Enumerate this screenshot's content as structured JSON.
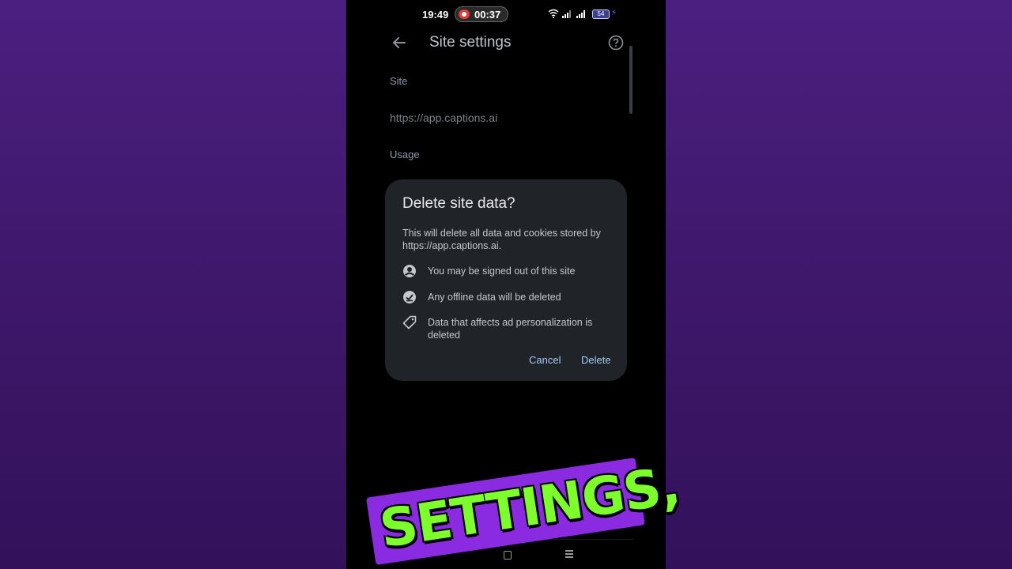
{
  "status_bar": {
    "time": "19:49",
    "recording_time": "00:37",
    "battery_level": "54"
  },
  "app_bar": {
    "title": "Site settings"
  },
  "site_section": {
    "label": "Site",
    "url": "https://app.captions.ai"
  },
  "usage_section": {
    "label": "Usage"
  },
  "dialog": {
    "title": "Delete site data?",
    "body": "This will delete all data and cookies stored by https://app.captions.ai.",
    "bullets": [
      {
        "icon": "account-circle-icon",
        "text": "You may be signed out of this site"
      },
      {
        "icon": "offline-check-icon",
        "text": "Any offline data will be deleted"
      },
      {
        "icon": "tag-icon",
        "text": "Data that affects ad personalization is deleted"
      }
    ],
    "cancel_label": "Cancel",
    "delete_label": "Delete"
  },
  "caption_overlay": {
    "text": "SETTINGS,"
  },
  "colors": {
    "background_purple": "#4b1f80",
    "dialog_bg": "#202428",
    "button_text": "#a8c7fa",
    "caption_green": "#7cff2b",
    "caption_box": "#8a2be2"
  }
}
